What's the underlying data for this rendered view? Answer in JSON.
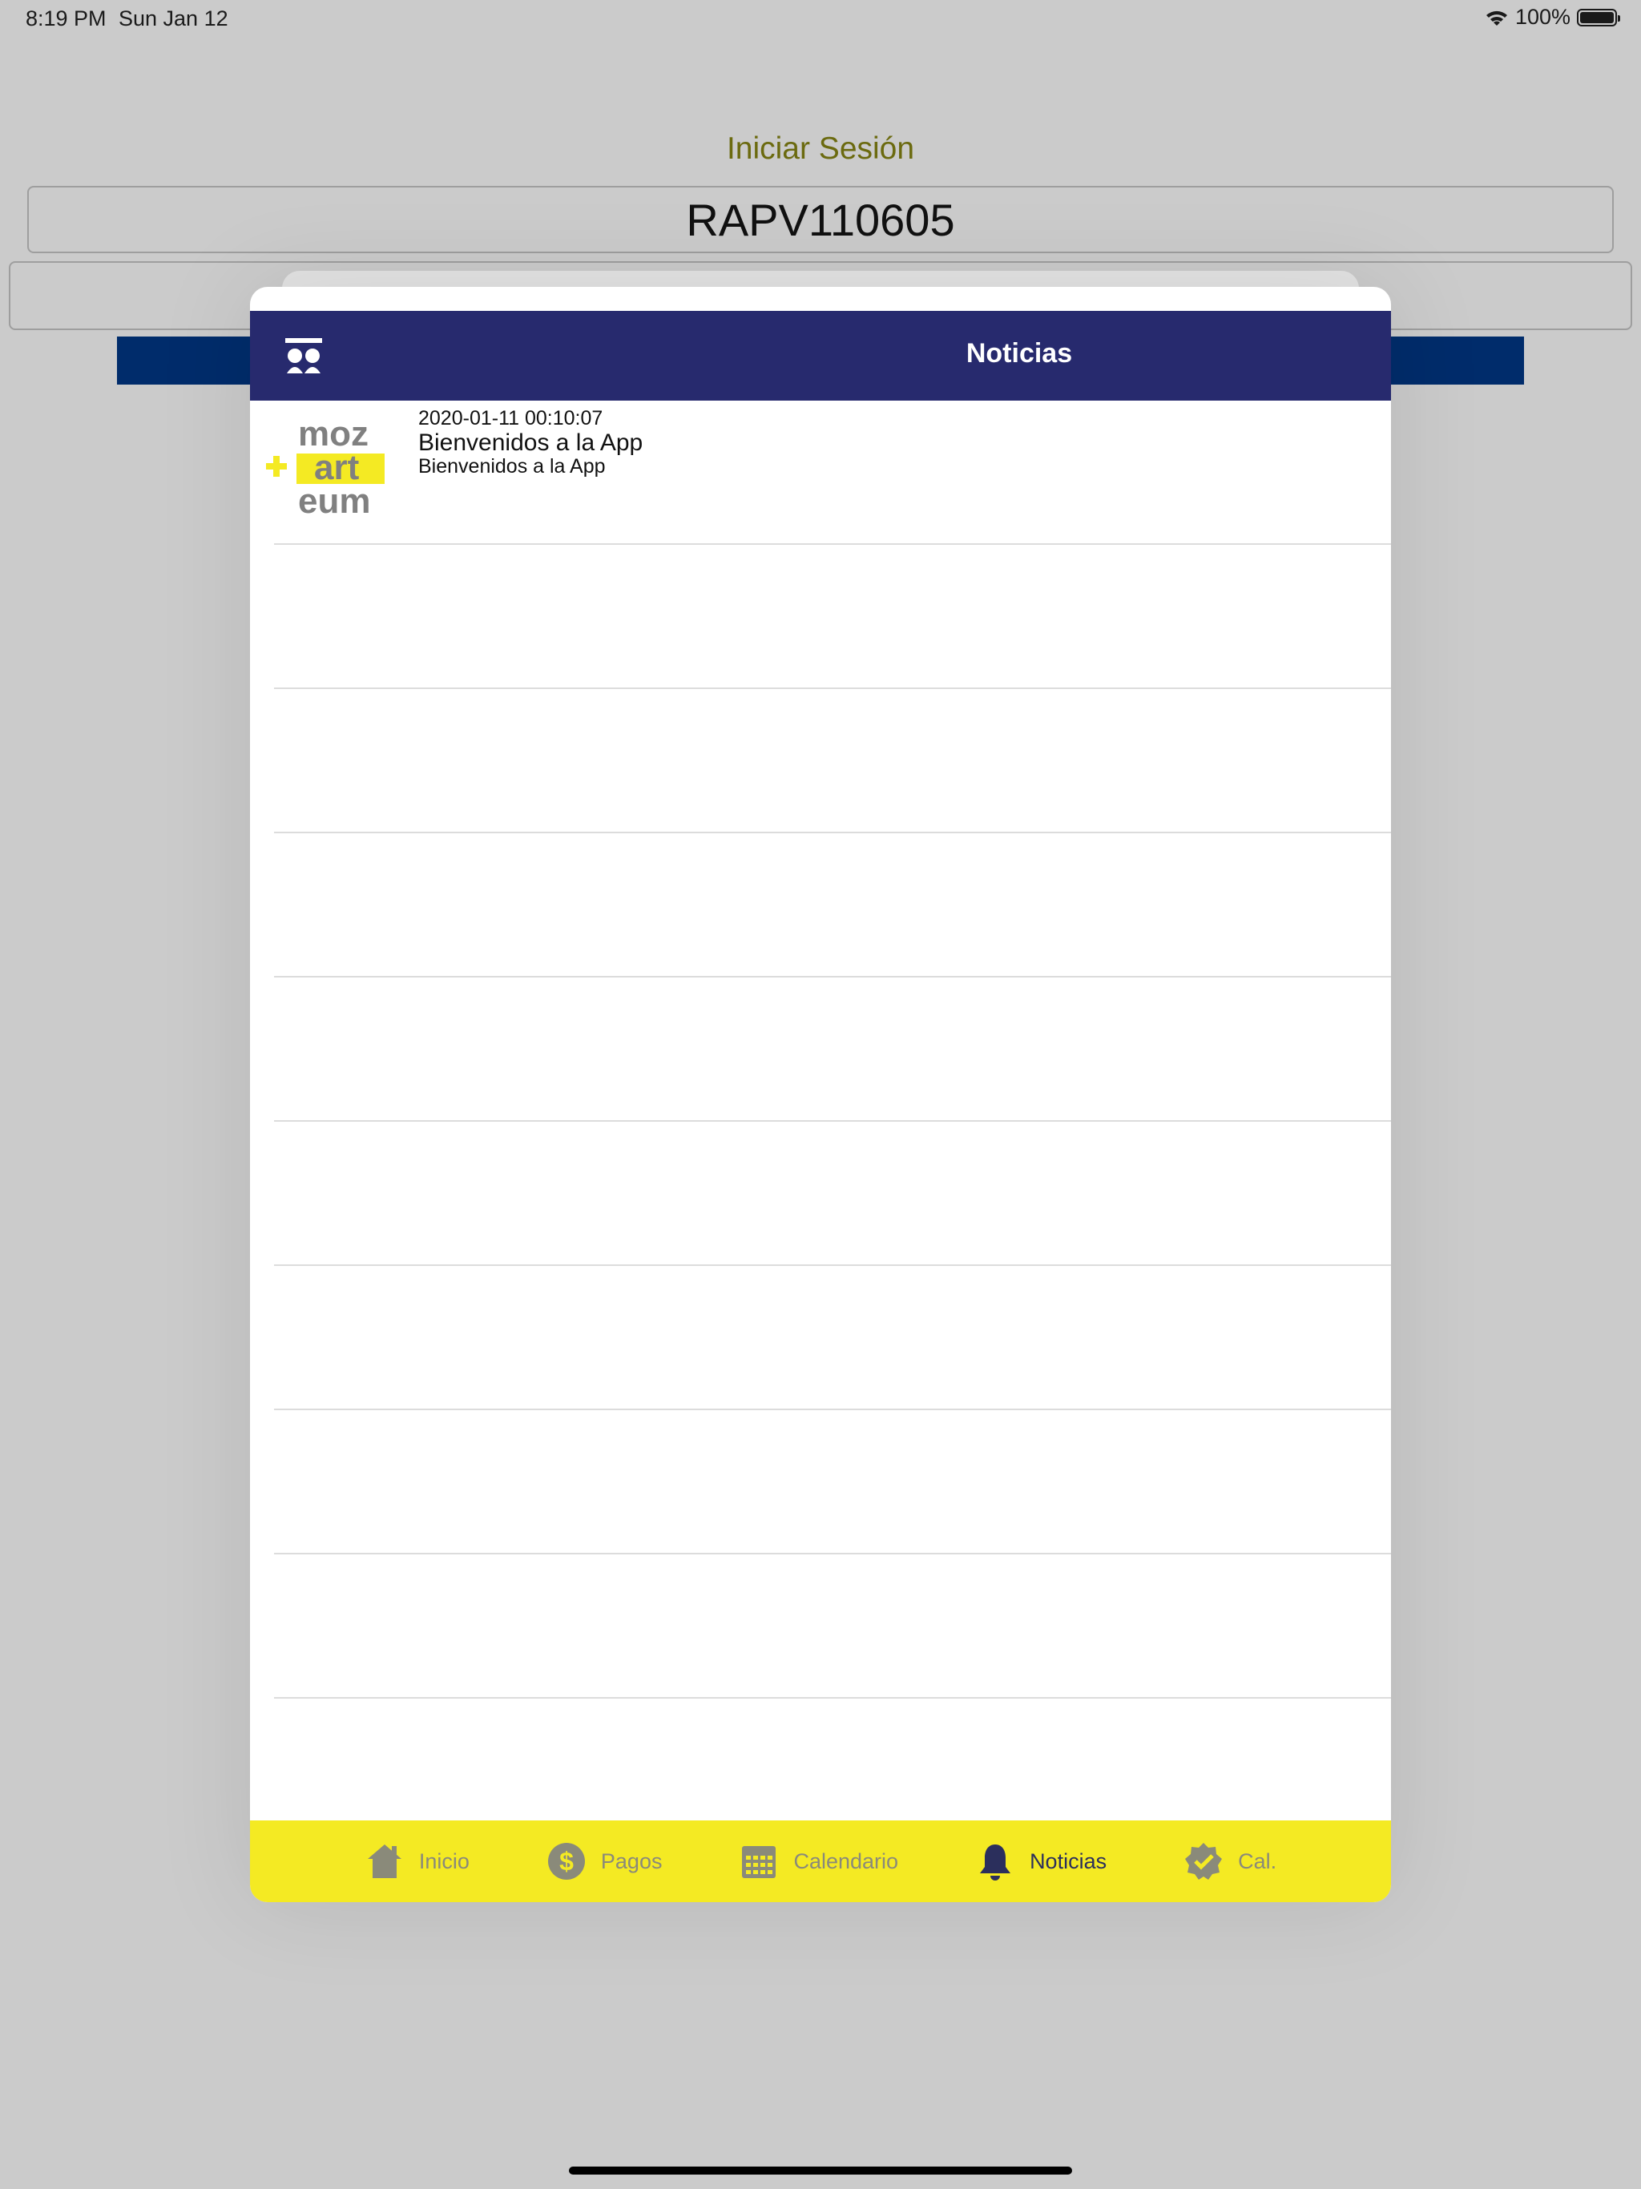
{
  "status_bar": {
    "time": "8:19 PM",
    "date": "Sun Jan 12",
    "battery": "100%"
  },
  "login": {
    "title": "Iniciar Sesión",
    "username_value": "RAPV110605"
  },
  "modal": {
    "nav_title": "Noticias",
    "news": [
      {
        "date": "2020-01-11 00:10:07",
        "title": "Bienvenidos a la App",
        "body": "Bienvenidos a la App",
        "logo_text": [
          "moz",
          "art",
          "eum"
        ]
      }
    ],
    "tabs": [
      {
        "label": "Inicio",
        "icon": "home-icon",
        "active": false
      },
      {
        "label": "Pagos",
        "icon": "dollar-icon",
        "active": false
      },
      {
        "label": "Calendario",
        "icon": "calendar-icon",
        "active": false
      },
      {
        "label": "Noticias",
        "icon": "bell-icon",
        "active": true
      },
      {
        "label": "Cal.",
        "icon": "badge-check-icon",
        "active": false
      }
    ]
  },
  "colors": {
    "nav": "#272a6e",
    "tab_bar": "#f4ea23",
    "login_button": "#002c6b",
    "title": "#6b6a0f"
  }
}
